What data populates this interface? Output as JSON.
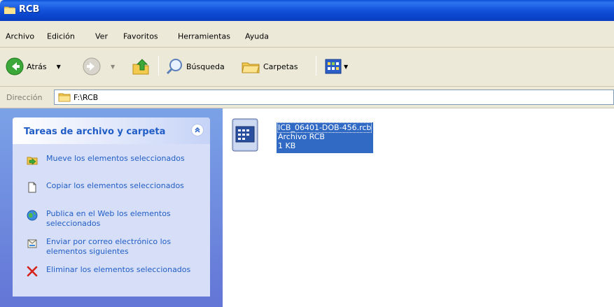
{
  "window": {
    "title": "RCB"
  },
  "menu": [
    "Archivo",
    "Edición",
    "Ver",
    "Favoritos",
    "Herramientas",
    "Ayuda"
  ],
  "toolbar": {
    "back_label": "Atrás",
    "search_label": "Búsqueda",
    "folders_label": "Carpetas"
  },
  "address": {
    "label": "Dirección",
    "value": "F:\\RCB"
  },
  "tasks": {
    "title": "Tareas de archivo y carpeta",
    "items": [
      {
        "label": "Mueve los elementos seleccionados",
        "icon": "move-icon"
      },
      {
        "label": "Copiar los elementos seleccionados",
        "icon": "copy-icon"
      },
      {
        "label": "Publica en el Web los elementos seleccionados",
        "icon": "globe-icon"
      },
      {
        "label": "Enviar por correo electrónico los elementos siguientes",
        "icon": "envelope-icon"
      },
      {
        "label": "Eliminar los elementos seleccionados",
        "icon": "delete-x-icon"
      }
    ]
  },
  "file": {
    "name": "ICB_06401-DOB-456.rcb",
    "type": "Archivo RCB",
    "size": "1 KB"
  },
  "colors": {
    "titlebar": "#0a4fd6",
    "selection": "#316ac5",
    "task_link": "#215dc6"
  }
}
